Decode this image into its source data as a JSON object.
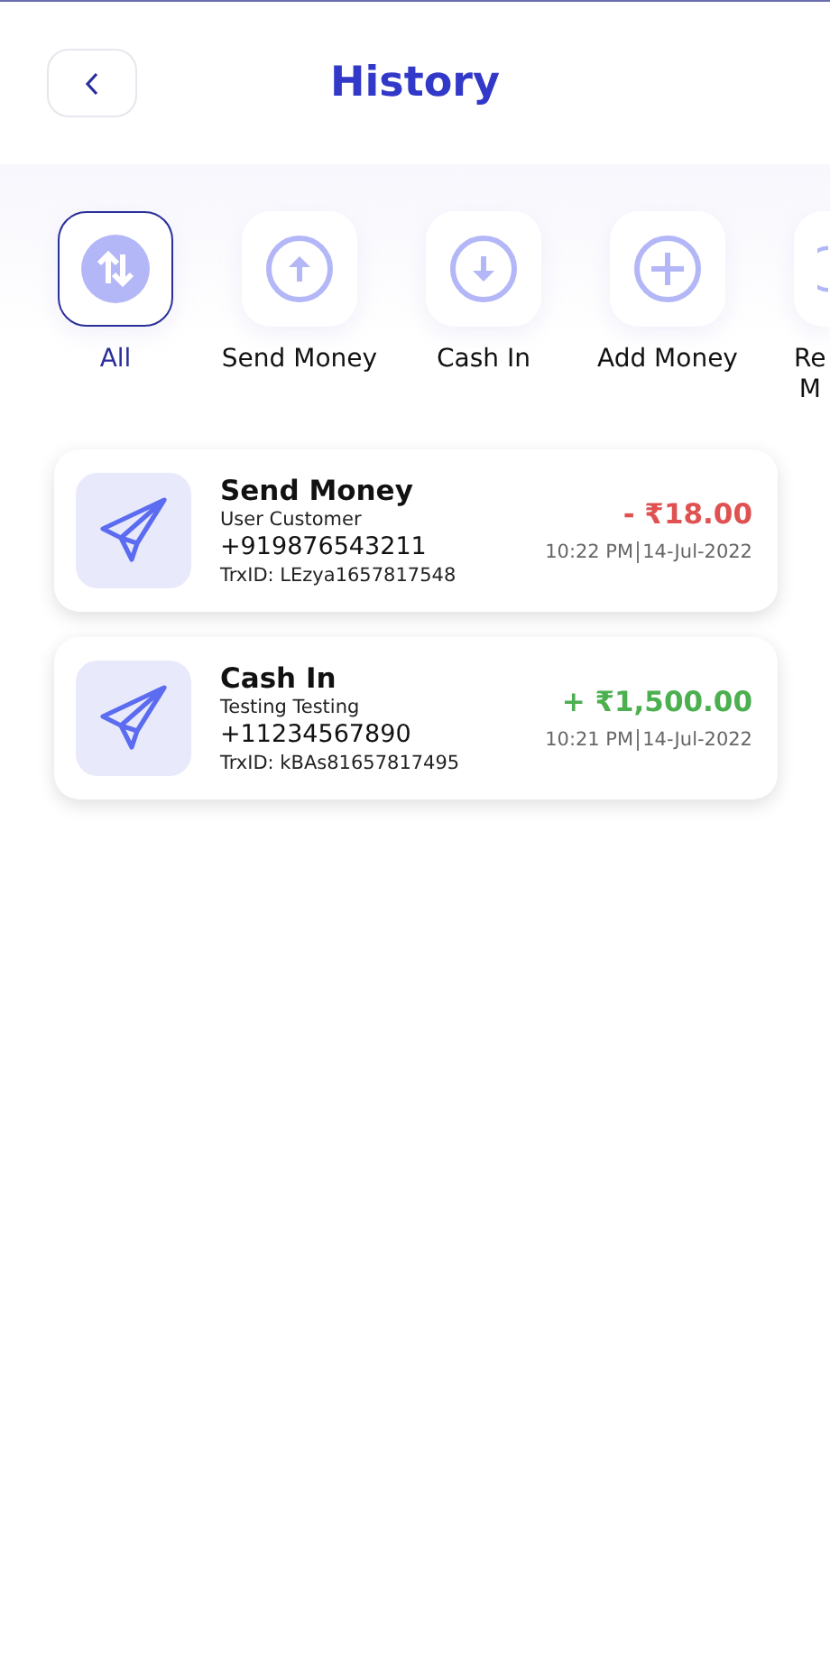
{
  "header": {
    "title": "History"
  },
  "filters": [
    {
      "label": "All",
      "kind": "swap",
      "selected": true
    },
    {
      "label": "Send Money",
      "kind": "up",
      "selected": false
    },
    {
      "label": "Cash In",
      "kind": "down",
      "selected": false
    },
    {
      "label": "Add Money",
      "kind": "plus",
      "selected": false
    },
    {
      "label": "Re\nM",
      "kind": "partial",
      "selected": false
    }
  ],
  "transactions": [
    {
      "title": "Send Money",
      "name": "User Customer",
      "phone": "+919876543211",
      "trx_id": "TrxID: LEzya1657817548",
      "amount": "- ₹18.00",
      "kind": "debit",
      "time": "10:22 PM",
      "date": "14-Jul-2022"
    },
    {
      "title": "Cash In",
      "name": "Testing Testing",
      "phone": "+11234567890",
      "trx_id": "TrxID: kBAs81657817495",
      "amount": "+ ₹1,500.00",
      "kind": "credit",
      "time": "10:21 PM",
      "date": "14-Jul-2022"
    }
  ]
}
